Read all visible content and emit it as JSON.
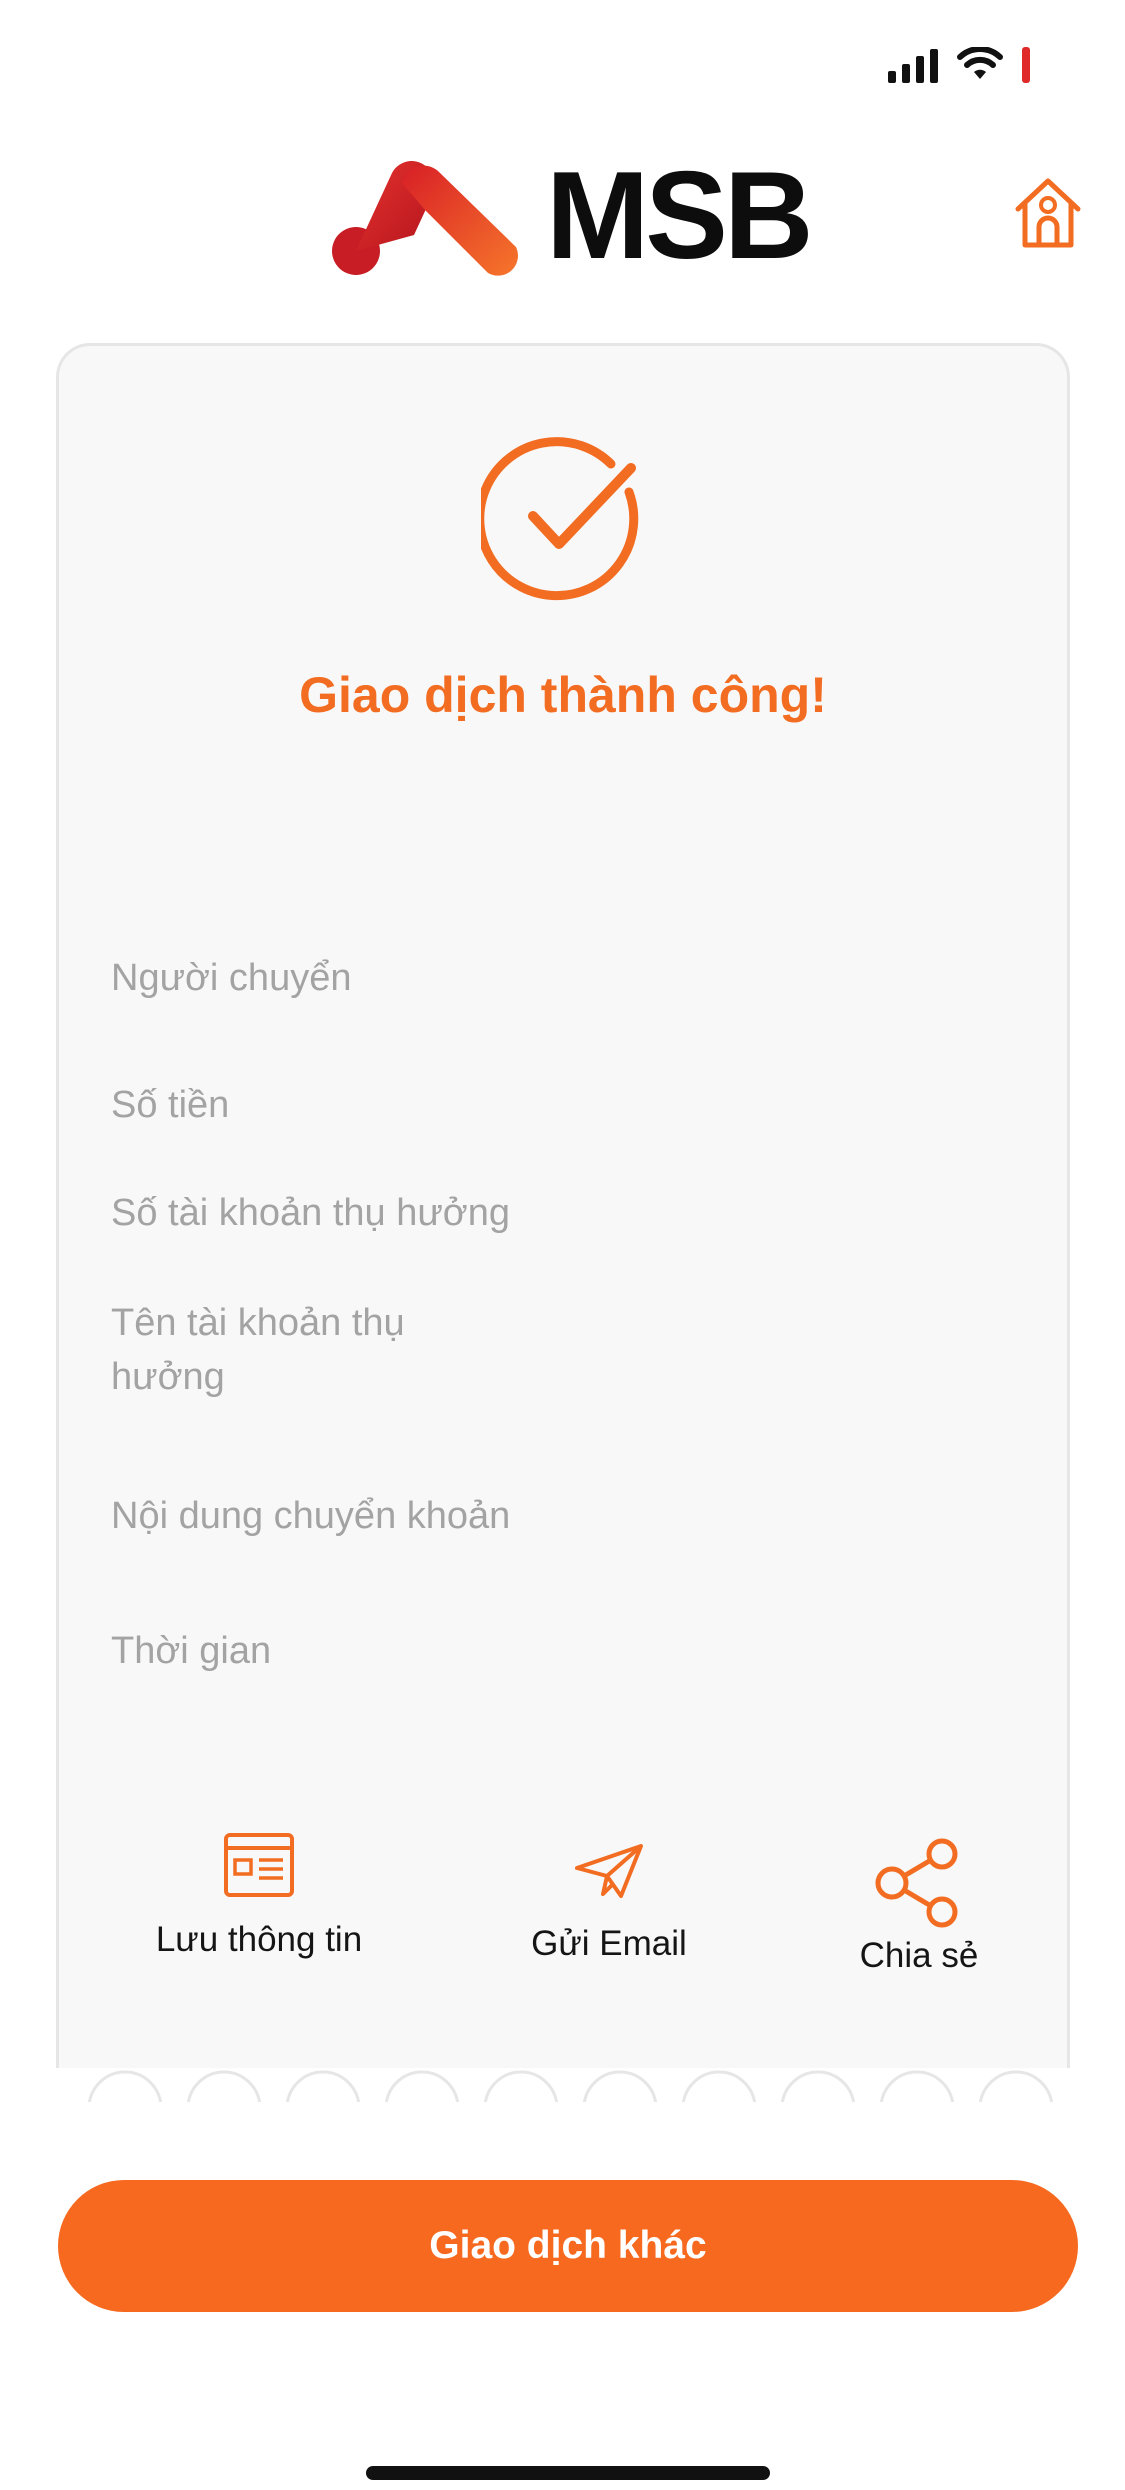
{
  "app": {
    "brand_name": "MSB",
    "brand_color": "#f26c21",
    "button_color": "#f6691e"
  },
  "status_bar": {
    "icons": [
      "cellular-signal-icon",
      "wifi-icon",
      "battery-icon"
    ]
  },
  "result": {
    "title": "Giao dịch thành công!",
    "icon": "check-circle-icon"
  },
  "details": {
    "sender_label": "Người chuyển",
    "amount_label": "Số tiền",
    "beneficiary_account_label": "Số tài khoản thụ hưởng",
    "beneficiary_name_label_line1": "Tên tài khoản thụ",
    "beneficiary_name_label_line2": "hưởng",
    "content_label": "Nội dung chuyển khoản",
    "time_label": "Thời gian"
  },
  "actions": {
    "save_label": "Lưu thông tin",
    "email_label": "Gửi Email",
    "share_label": "Chia sẻ"
  },
  "footer": {
    "other_transaction_label": "Giao dịch khác"
  }
}
